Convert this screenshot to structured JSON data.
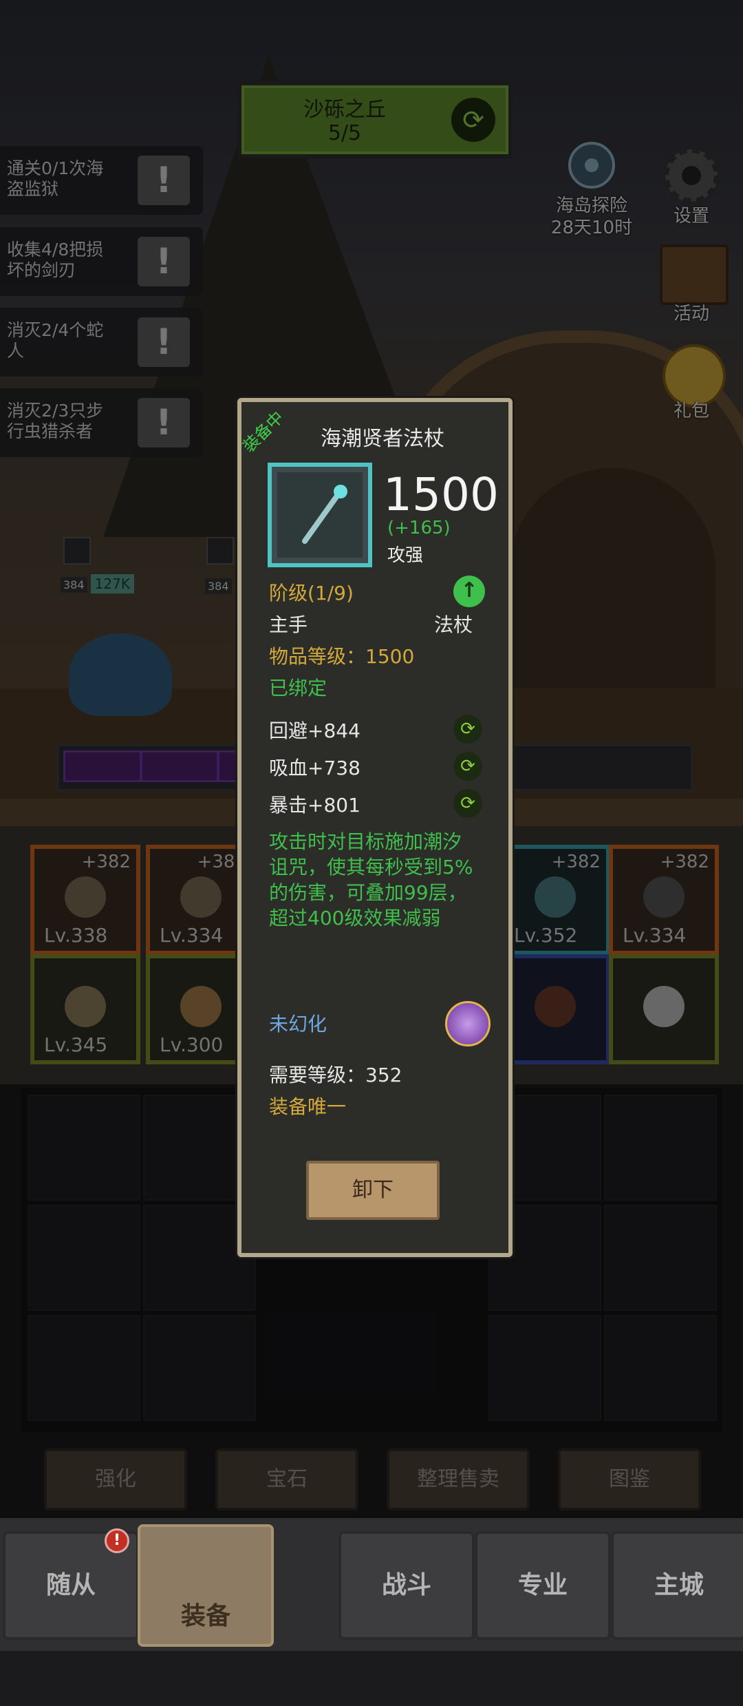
{
  "location": {
    "name": "沙砾之丘",
    "progress": "5/5"
  },
  "quests": [
    {
      "text": "通关0/1次海盗监狱",
      "badge": "!"
    },
    {
      "text": "收集4/8把损坏的剑刃",
      "badge": "!"
    },
    {
      "text": "消灭2/4个蛇人",
      "badge": "!"
    },
    {
      "text": "消灭2/3只步行虫猎杀者",
      "badge": "!"
    }
  ],
  "right_menu": {
    "island": {
      "label": "海岛探险",
      "timer": "28天10时"
    },
    "settings": "设置",
    "activity": "活动",
    "gift": "礼包"
  },
  "hero_bar": {
    "level1": "384",
    "hp": "127K",
    "level2": "384"
  },
  "equipment": [
    {
      "plus": "+382",
      "lv": "Lv.338",
      "color": "orange"
    },
    {
      "plus": "+382",
      "lv": "Lv.334",
      "color": "orange"
    },
    {
      "plus": "+382",
      "lv": "Lv.352",
      "color": "teal"
    },
    {
      "plus": "+382",
      "lv": "Lv.334",
      "color": "orange"
    },
    {
      "plus": "",
      "lv": "Lv.345",
      "color": "green"
    },
    {
      "plus": "",
      "lv": "Lv.300",
      "color": "green"
    },
    {
      "plus": "",
      "lv": "",
      "color": "blue"
    },
    {
      "plus": "",
      "lv": "",
      "color": "green"
    }
  ],
  "actions": [
    "强化",
    "宝石",
    "整理售卖",
    "图鉴"
  ],
  "nav": {
    "items": [
      "随从",
      "装备",
      "战斗",
      "专业",
      "主城"
    ],
    "notice": "!"
  },
  "tooltip": {
    "equipped": "装备中",
    "title": "海潮贤者法杖",
    "power": "1500",
    "power_delta": "(+165)",
    "power_type": "攻强",
    "tier": "阶级(1/9)",
    "slot": "主手",
    "item_type": "法杖",
    "item_level": "物品等级：1500",
    "bound": "已绑定",
    "stats": [
      {
        "label": "回避+844"
      },
      {
        "label": "吸血+738"
      },
      {
        "label": "暴击+801"
      }
    ],
    "description": "攻击时对目标施加潮汐诅咒，使其每秒受到5%的伤害，可叠加99层，超过400级效果减弱",
    "illusion": "未幻化",
    "required_level": "需要等级：352",
    "unique": "装备唯一",
    "unload_button": "卸下"
  },
  "colors": {
    "tooltip_border": "#b3a88c",
    "green_text": "#3fbf4b",
    "gold_text": "#d4a93c",
    "frame": "#4fc4c4"
  }
}
